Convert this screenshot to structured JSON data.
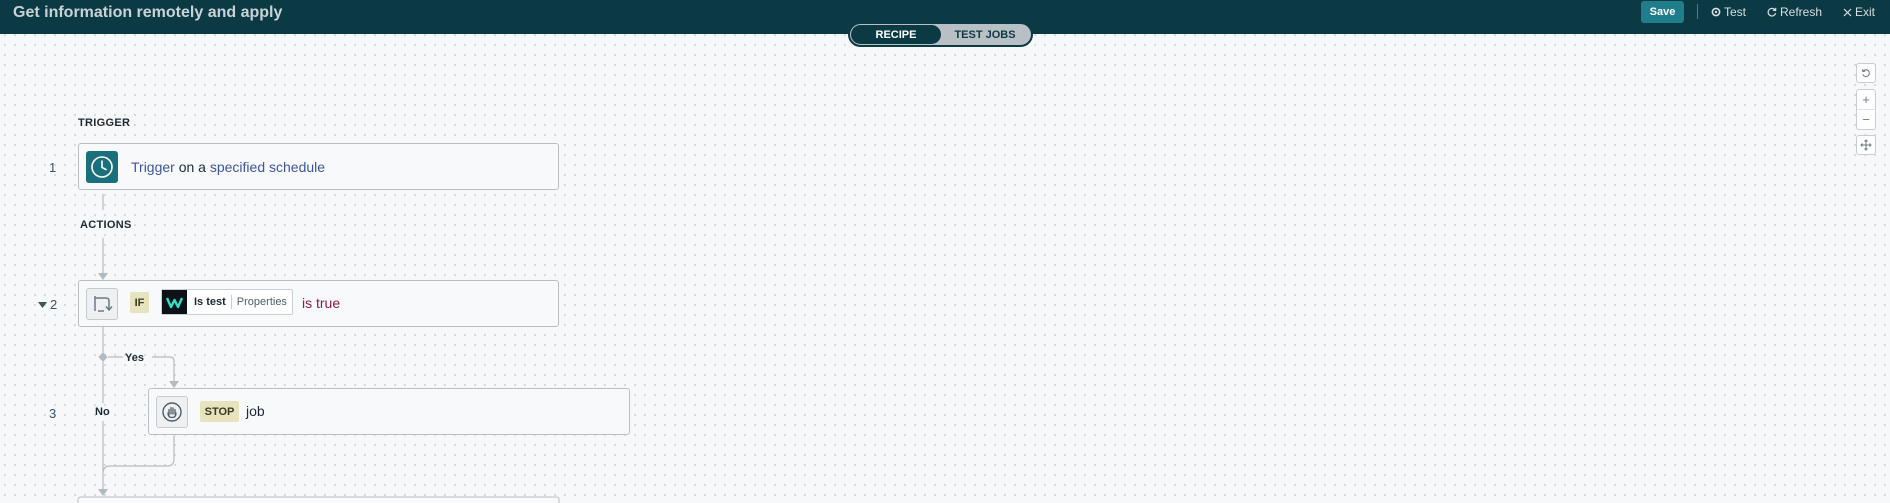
{
  "header": {
    "title": "Get information remotely and apply",
    "view_tabs": [
      {
        "label": "RECIPE",
        "active": true
      },
      {
        "label": "TEST JOBS",
        "active": false
      }
    ],
    "save_label": "Save",
    "test_label": "Test",
    "refresh_label": "Refresh",
    "exit_label": "Exit"
  },
  "canvas_controls": {
    "reset_icon": "rotate-icon",
    "zoom_in_label": "+",
    "zoom_out_label": "−",
    "fit_icon": "fit-view-icon"
  },
  "recipe": {
    "trigger_section": "TRIGGER",
    "actions_section": "ACTIONS",
    "steps": [
      {
        "number": "1",
        "icon": "clock-icon",
        "parts": [
          "Trigger",
          " on a ",
          "specified schedule"
        ]
      },
      {
        "number": "2",
        "icon": "branch-icon",
        "keyword": "IF",
        "app_logo": "workato-logo",
        "field": "Is test",
        "field_source": "Properties",
        "condition": "is true"
      },
      {
        "number": "3",
        "icon": "hand-stop-icon",
        "keyword": "STOP",
        "text": "job"
      }
    ],
    "branch_yes": "Yes",
    "branch_no": "No"
  },
  "colors": {
    "header_bg": "#0b3a45",
    "accent": "#1f7d8c",
    "link": "#3e55a0",
    "condition": "#8a1d43",
    "keyword_bg": "#e7e3bd"
  }
}
